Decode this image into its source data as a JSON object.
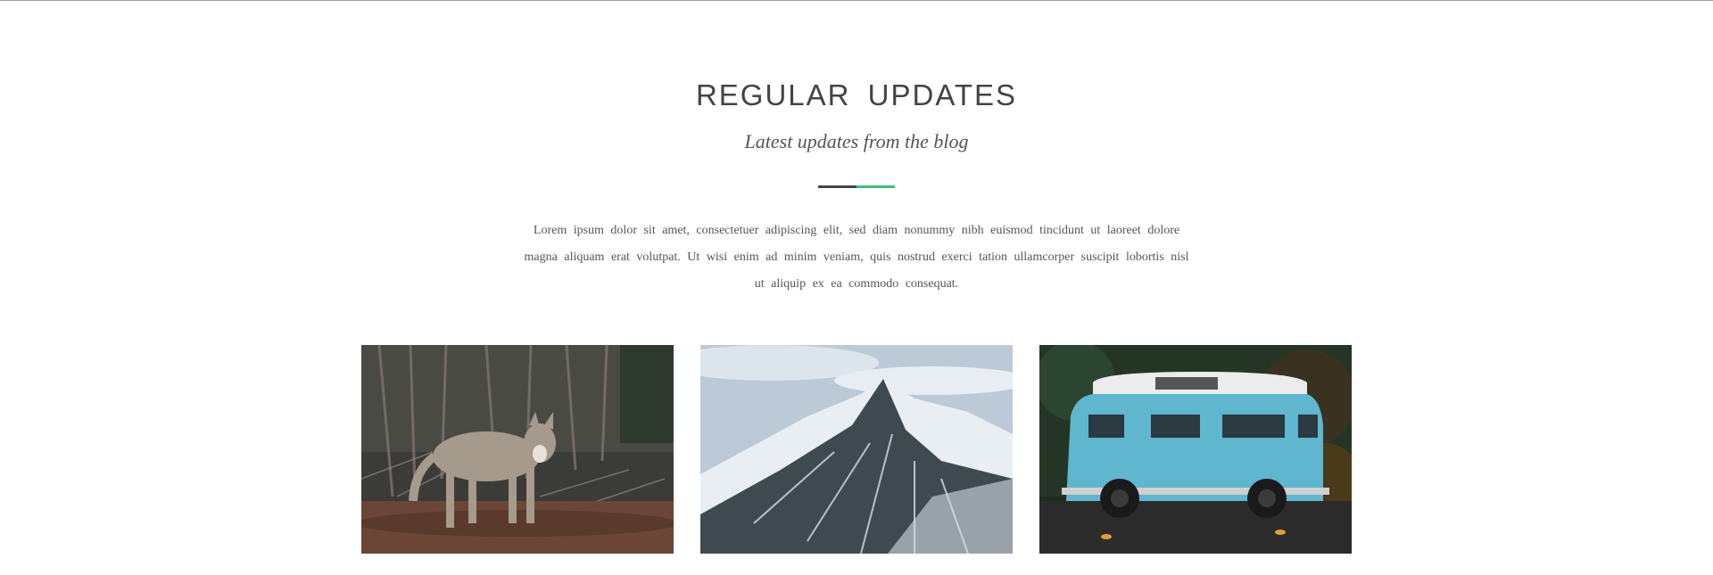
{
  "section": {
    "title": "REGULAR  UPDATES",
    "subtitle": "Latest updates from the blog",
    "intro": "Lorem ipsum dolor sit amet, consectetuer adipiscing elit, sed diam nonummy nibh euismod tincidunt ut laoreet dolore magna aliquam erat volutpat. Ut wisi enim ad minim veniam, quis nostrud exerci tation ullamcorper suscipit lobortis nisl ut aliquip ex ea commodo consequat."
  },
  "colors": {
    "accent": "#3cc07a",
    "heading": "#444444",
    "text": "#555555"
  },
  "posts": [
    {
      "image": "wolf-photo"
    },
    {
      "image": "snowy-mountain-photo"
    },
    {
      "image": "blue-van-photo"
    }
  ]
}
